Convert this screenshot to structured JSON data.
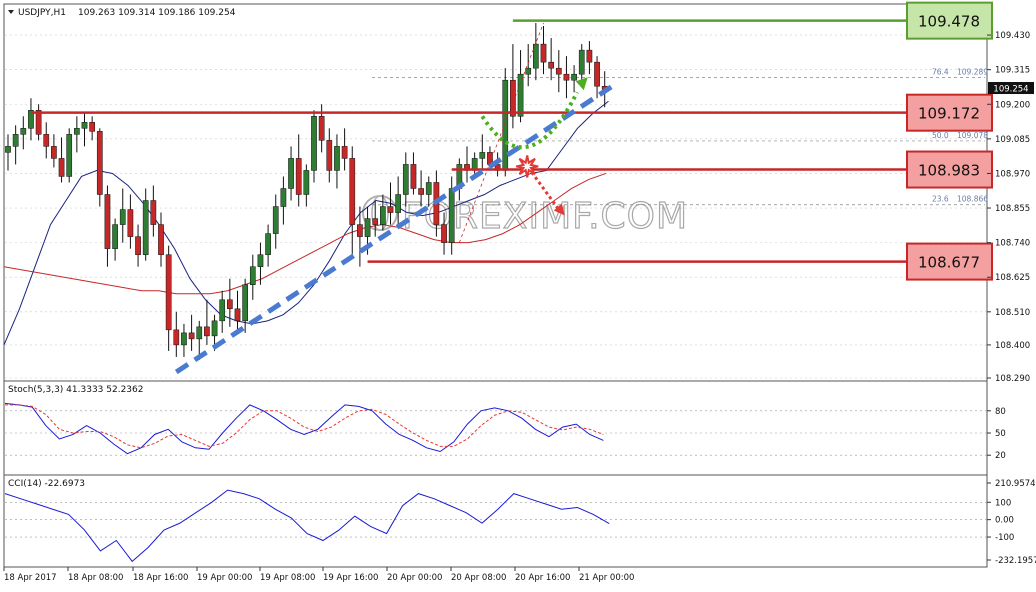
{
  "header": {
    "symbol": "USDJPY,H1",
    "ohlc": "109.263 109.314 109.186 109.254"
  },
  "watermark": "FOREXIMF.COM",
  "colors": {
    "bull_candle": "#2e7d32",
    "bear_candle": "#c62828",
    "ma_fast": "#1a237e",
    "ma_slow": "#c62828",
    "trendline": "#4a7bd1",
    "resistance_box": "#f4a0a0",
    "resistance_border": "#c62828",
    "target_box": "#c6e5a8",
    "target_border": "#5a9e2f",
    "grid": "#999999"
  },
  "chart_data": [
    {
      "type": "candlestick",
      "panel": "price",
      "ylim": [
        108.29,
        109.52
      ],
      "y_ticks": [
        "109.430",
        "109.315",
        "109.200",
        "109.085",
        "108.970",
        "108.855",
        "108.740",
        "108.625",
        "108.510",
        "108.400",
        "108.290"
      ],
      "current_price": "109.254",
      "x_ticks": [
        "18 Apr 2017",
        "18 Apr 08:00",
        "18 Apr 16:00",
        "19 Apr 00:00",
        "19 Apr 08:00",
        "19 Apr 16:00",
        "20 Apr 00:00",
        "20 Apr 08:00",
        "20 Apr 16:00",
        "21 Apr 00:00"
      ],
      "candles": [
        [
          109.04,
          109.1,
          108.98,
          109.06
        ],
        [
          109.06,
          109.13,
          109.0,
          109.1
        ],
        [
          109.1,
          109.16,
          109.05,
          109.12
        ],
        [
          109.12,
          109.22,
          109.08,
          109.18
        ],
        [
          109.18,
          109.2,
          109.08,
          109.1
        ],
        [
          109.1,
          109.14,
          109.02,
          109.06
        ],
        [
          109.06,
          109.1,
          108.99,
          109.02
        ],
        [
          109.02,
          109.09,
          108.94,
          108.96
        ],
        [
          108.96,
          109.12,
          108.94,
          109.1
        ],
        [
          109.1,
          109.16,
          109.04,
          109.12
        ],
        [
          109.12,
          109.17,
          109.06,
          109.14
        ],
        [
          109.14,
          109.16,
          109.08,
          109.11
        ],
        [
          109.11,
          109.12,
          108.86,
          108.9
        ],
        [
          108.9,
          108.93,
          108.66,
          108.72
        ],
        [
          108.72,
          108.82,
          108.68,
          108.8
        ],
        [
          108.8,
          108.92,
          108.74,
          108.85
        ],
        [
          108.85,
          108.9,
          108.72,
          108.76
        ],
        [
          108.76,
          108.8,
          108.66,
          108.7
        ],
        [
          108.7,
          108.92,
          108.68,
          108.88
        ],
        [
          108.88,
          108.93,
          108.76,
          108.8
        ],
        [
          108.8,
          108.84,
          108.66,
          108.7
        ],
        [
          108.7,
          108.73,
          108.38,
          108.45
        ],
        [
          108.45,
          108.51,
          108.36,
          108.4
        ],
        [
          108.4,
          108.47,
          108.36,
          108.44
        ],
        [
          108.44,
          108.5,
          108.38,
          108.42
        ],
        [
          108.42,
          108.48,
          108.35,
          108.46
        ],
        [
          108.46,
          108.55,
          108.4,
          108.43
        ],
        [
          108.43,
          108.5,
          108.38,
          108.48
        ],
        [
          108.48,
          108.58,
          108.44,
          108.55
        ],
        [
          108.55,
          108.62,
          108.46,
          108.52
        ],
        [
          108.52,
          108.58,
          108.45,
          108.48
        ],
        [
          108.48,
          108.62,
          108.44,
          108.6
        ],
        [
          108.6,
          108.7,
          108.55,
          108.66
        ],
        [
          108.66,
          108.74,
          108.6,
          108.7
        ],
        [
          108.7,
          108.8,
          108.66,
          108.77
        ],
        [
          108.77,
          108.9,
          108.72,
          108.86
        ],
        [
          108.86,
          108.96,
          108.8,
          108.92
        ],
        [
          108.92,
          109.06,
          108.88,
          109.02
        ],
        [
          109.02,
          109.1,
          108.86,
          108.9
        ],
        [
          108.9,
          109.0,
          108.86,
          108.98
        ],
        [
          108.98,
          109.18,
          108.94,
          109.16
        ],
        [
          109.16,
          109.2,
          109.04,
          109.08
        ],
        [
          109.08,
          109.12,
          108.94,
          108.98
        ],
        [
          108.98,
          109.1,
          108.92,
          109.06
        ],
        [
          109.06,
          109.12,
          108.98,
          109.02
        ],
        [
          109.02,
          109.06,
          108.7,
          108.8
        ],
        [
          108.8,
          108.86,
          108.66,
          108.76
        ],
        [
          108.76,
          108.86,
          108.7,
          108.82
        ],
        [
          108.82,
          108.88,
          108.76,
          108.8
        ],
        [
          108.8,
          108.9,
          108.78,
          108.86
        ],
        [
          108.86,
          108.94,
          108.8,
          108.84
        ],
        [
          108.84,
          108.96,
          108.8,
          108.9
        ],
        [
          108.9,
          109.04,
          108.86,
          109.0
        ],
        [
          109.0,
          109.04,
          108.9,
          108.92
        ],
        [
          108.92,
          108.98,
          108.86,
          108.9
        ],
        [
          108.9,
          108.96,
          108.86,
          108.94
        ],
        [
          108.94,
          108.98,
          108.76,
          108.8
        ],
        [
          108.8,
          108.84,
          108.7,
          108.74
        ],
        [
          108.74,
          108.96,
          108.7,
          108.92
        ],
        [
          108.92,
          109.02,
          108.88,
          109.0
        ],
        [
          109.0,
          109.06,
          108.94,
          108.98
        ],
        [
          108.98,
          109.04,
          108.96,
          109.02
        ],
        [
          109.02,
          109.1,
          108.98,
          109.04
        ],
        [
          109.04,
          109.06,
          108.98,
          109.0
        ],
        [
          109.0,
          109.04,
          108.96,
          108.98
        ],
        [
          108.98,
          109.32,
          108.96,
          109.28
        ],
        [
          109.28,
          109.4,
          109.12,
          109.16
        ],
        [
          109.16,
          109.38,
          109.14,
          109.3
        ],
        [
          109.3,
          109.4,
          109.26,
          109.32
        ],
        [
          109.32,
          109.47,
          109.28,
          109.4
        ],
        [
          109.4,
          109.46,
          109.3,
          109.34
        ],
        [
          109.34,
          109.42,
          109.28,
          109.32
        ],
        [
          109.32,
          109.38,
          109.24,
          109.3
        ],
        [
          109.3,
          109.36,
          109.22,
          109.28
        ],
        [
          109.28,
          109.33,
          109.24,
          109.3
        ],
        [
          109.3,
          109.4,
          109.26,
          109.38
        ],
        [
          109.38,
          109.41,
          109.3,
          109.34
        ],
        [
          109.34,
          109.36,
          109.22,
          109.26
        ],
        [
          109.26,
          109.31,
          109.19,
          109.25
        ]
      ],
      "series": [
        {
          "values": [
            108.4,
            108.52,
            108.66,
            108.8,
            108.88,
            108.96,
            108.98,
            108.97,
            108.93,
            108.87,
            108.8,
            108.72,
            108.62,
            108.55,
            108.5,
            108.48,
            108.47,
            108.48,
            108.5,
            108.54,
            108.6,
            108.68,
            108.77,
            108.84,
            108.88,
            108.87,
            108.84,
            108.83,
            108.84,
            108.86,
            108.88,
            108.9,
            108.93,
            108.95,
            108.97,
            108.98,
            109.05,
            109.12,
            109.17,
            109.21
          ]
        },
        {
          "values": [
            108.66,
            108.65,
            108.64,
            108.63,
            108.62,
            108.61,
            108.6,
            108.59,
            108.58,
            108.58,
            108.57,
            108.57,
            108.57,
            108.58,
            108.6,
            108.62,
            108.65,
            108.68,
            108.71,
            108.74,
            108.77,
            108.79,
            108.8,
            108.79,
            108.77,
            108.75,
            108.74,
            108.74,
            108.75,
            108.77,
            108.8,
            108.84,
            108.88,
            108.92,
            108.95,
            108.97
          ]
        }
      ],
      "levels": [
        {
          "label": "109.478",
          "value": 109.478
        },
        {
          "label": "109.172",
          "value": 109.172
        },
        {
          "label": "108.983",
          "value": 108.983
        },
        {
          "label": "108.677",
          "value": 108.677
        }
      ],
      "fib_levels": [
        {
          "label": "76.4",
          "price": "109.289",
          "value": 109.289
        },
        {
          "label": "50.0",
          "price": "109.078",
          "value": 109.078
        },
        {
          "label": "23.6",
          "price": "108.866",
          "value": 108.866
        }
      ],
      "trendline": [
        [
          22,
          108.31
        ],
        [
          79,
          109.26
        ]
      ],
      "scenario_up": {
        "from": [
          62,
          109.16
        ],
        "dip": [
          68,
          109.04
        ],
        "to": [
          75,
          109.27
        ]
      },
      "scenario_down": {
        "from": [
          68,
          108.99
        ],
        "to": [
          72,
          108.85
        ]
      }
    },
    {
      "type": "line",
      "panel": "stochastic",
      "header": "Stoch(5,3,3) 41.3333 52.2362",
      "ylim": [
        0,
        100
      ],
      "y_ticks": [
        "80",
        "50",
        "20"
      ],
      "series": [
        {
          "values": [
            90,
            88,
            85,
            60,
            42,
            48,
            60,
            50,
            35,
            22,
            30,
            48,
            55,
            38,
            30,
            28,
            50,
            70,
            88,
            80,
            68,
            55,
            48,
            55,
            72,
            88,
            86,
            80,
            62,
            48,
            40,
            30,
            25,
            38,
            62,
            80,
            84,
            80,
            70,
            55,
            45,
            58,
            62,
            48,
            40
          ]
        },
        {
          "values": [
            88,
            88,
            86,
            75,
            55,
            50,
            52,
            52,
            45,
            34,
            30,
            36,
            46,
            48,
            40,
            32,
            36,
            50,
            68,
            80,
            80,
            70,
            58,
            52,
            58,
            70,
            80,
            82,
            75,
            62,
            50,
            40,
            32,
            32,
            42,
            60,
            74,
            80,
            78,
            68,
            58,
            54,
            58,
            55,
            48
          ]
        }
      ]
    },
    {
      "type": "line",
      "panel": "cci",
      "header": "CCI(14) -22.6973",
      "ylim": [
        -232.1957,
        210.9574
      ],
      "y_ticks": [
        "210.9574",
        "100",
        "0.00",
        "-100",
        "-232.1957"
      ],
      "series": [
        {
          "values": [
            150,
            120,
            90,
            60,
            30,
            -60,
            -180,
            -120,
            -240,
            -160,
            -60,
            -20,
            40,
            100,
            170,
            150,
            120,
            60,
            10,
            -80,
            -120,
            -60,
            20,
            -40,
            -80,
            80,
            150,
            120,
            80,
            40,
            -20,
            60,
            150,
            120,
            90,
            60,
            70,
            30,
            -22.7
          ]
        }
      ]
    }
  ]
}
